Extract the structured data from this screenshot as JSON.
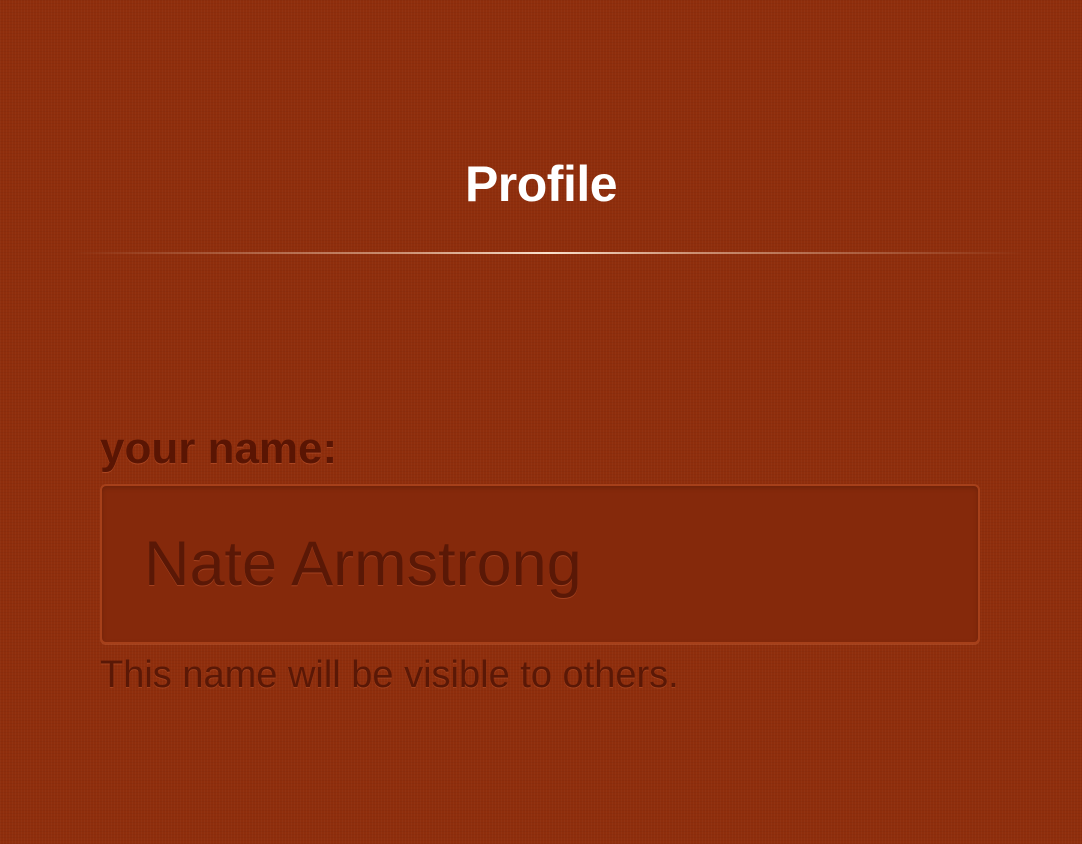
{
  "header": {
    "title": "Profile"
  },
  "form": {
    "name_label": "your name:",
    "name_value": "Nate Armstrong",
    "name_help": "This name will be visible to others."
  },
  "colors": {
    "background": "#8f2e0c",
    "title_text": "#ffffff",
    "label_text": "#5a1503",
    "input_background": "#85290b"
  }
}
